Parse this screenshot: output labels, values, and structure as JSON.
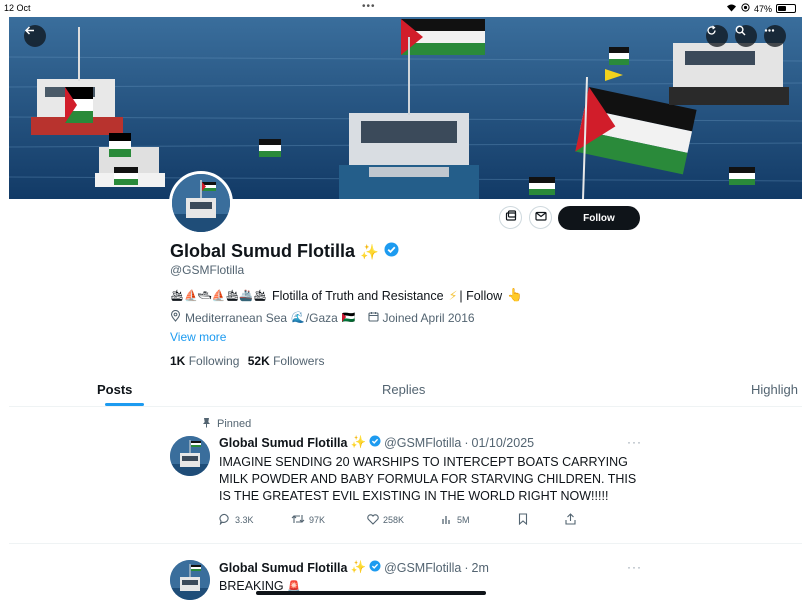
{
  "status_bar": {
    "time": "12 Oct",
    "dots": "•••",
    "battery_text": "47%",
    "battery_level": 0.47
  },
  "banner": {
    "back_icon": "arrow-left-icon",
    "refresh_icon": "refresh-icon",
    "search_icon": "search-icon",
    "more_icon": "more-icon"
  },
  "profile": {
    "name": "Global Sumud Flotilla",
    "name_emoji": "✨",
    "handle": "@GSMFlotilla",
    "bio_ships": "🛳⛵🛥⛵🛳🚢🛳",
    "bio_text": "Flotilla of Truth and Resistance",
    "bio_bolt": "⚡",
    "bio_follow": "| Follow",
    "bio_hand": "👆",
    "location": "Mediterranean Sea",
    "location_wave": "🌊",
    "location_gaza": "/Gaza",
    "location_flag": "🇵🇸",
    "joined": "Joined April 2016",
    "view_more": "View more",
    "following_count": "1K",
    "following_label": "Following",
    "followers_count": "52K",
    "followers_label": "Followers",
    "follow_button": "Follow"
  },
  "tabs": [
    {
      "label": "Posts",
      "active": true
    },
    {
      "label": "Replies",
      "active": false
    },
    {
      "label": "Highligh",
      "active": false
    }
  ],
  "posts": [
    {
      "pinned_label": "Pinned",
      "name": "Global Sumud Flotilla",
      "name_emoji": "✨",
      "handle": "@GSMFlotilla",
      "separator": "·",
      "time": "01/10/2025",
      "text": "IMAGINE SENDING 20 WARSHIPS TO INTERCEPT BOATS CARRYING MILK POWDER AND BABY FORMULA FOR STARVING CHILDREN. THIS IS THE GREATEST EVIL EXISTING IN THE WORLD RIGHT NOW!!!!!",
      "replies": "3.3K",
      "reposts": "97K",
      "likes": "258K",
      "views": "5M",
      "more": "···"
    },
    {
      "name": "Global Sumud Flotilla",
      "name_emoji": "✨",
      "handle": "@GSMFlotilla",
      "separator": "·",
      "time": "2m",
      "text": "BREAKING",
      "text_emoji": "🚨",
      "more": "···"
    }
  ],
  "colors": {
    "accent": "#1d9bf0",
    "text": "#0f1419",
    "secondary": "#536471",
    "verified": "#1d9bf0",
    "button_dark": "#0f1419"
  }
}
